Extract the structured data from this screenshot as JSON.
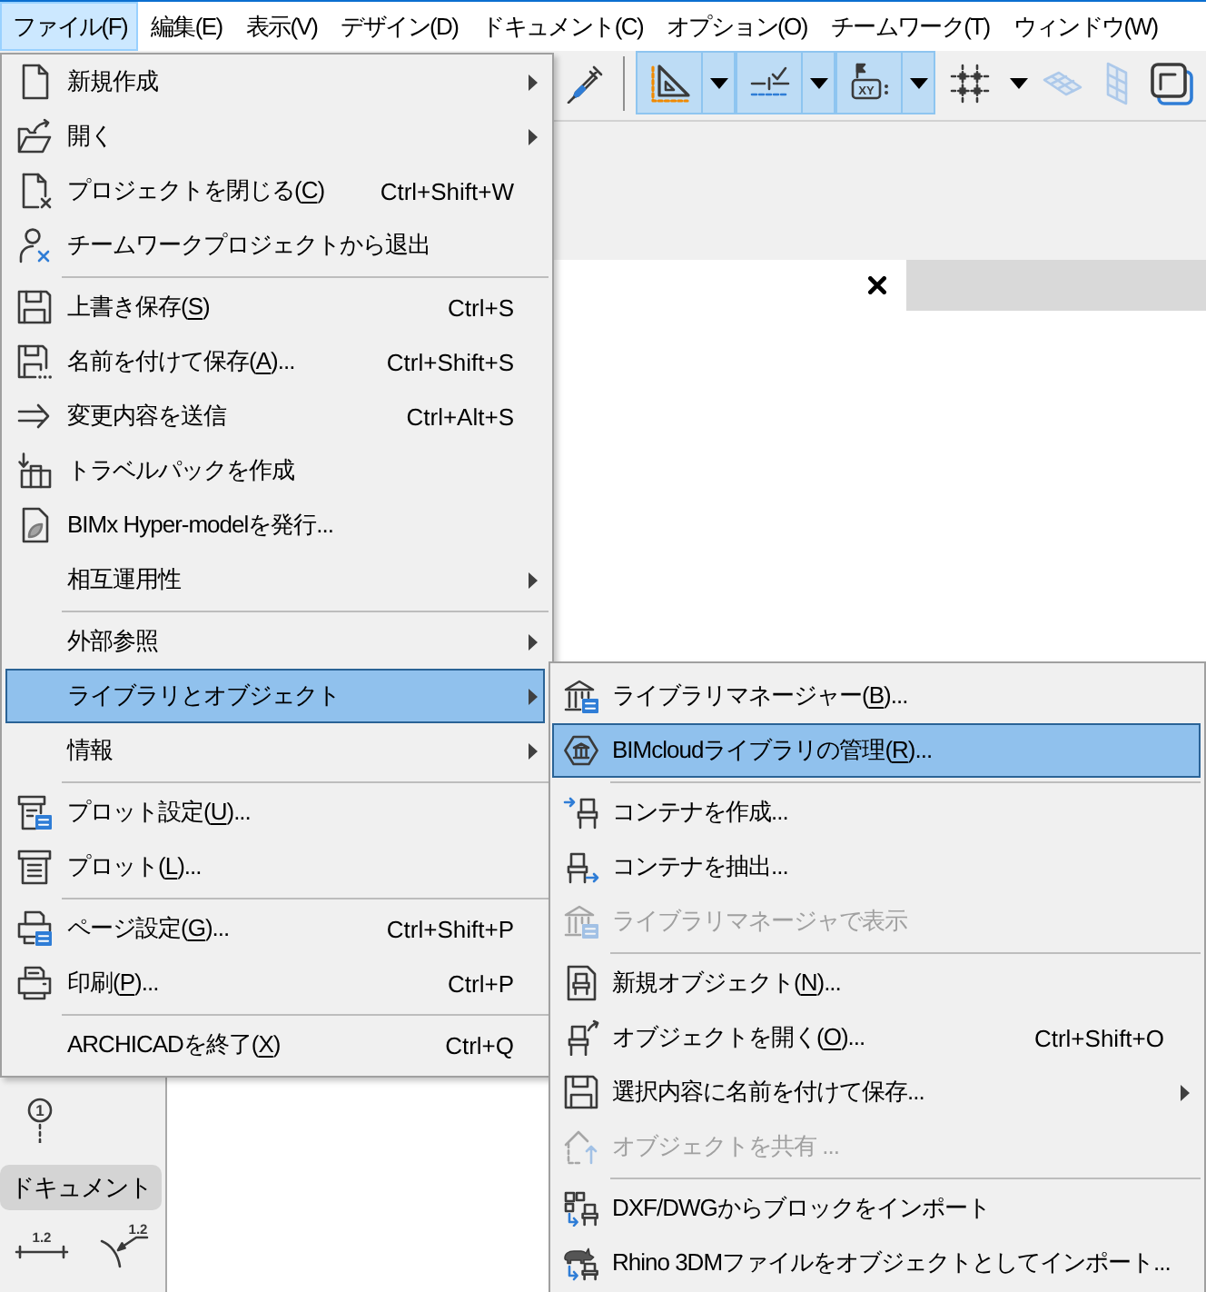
{
  "menu_bar": [
    {
      "label": "ファイル(F)",
      "selected": true
    },
    {
      "label": "編集(E)",
      "selected": false
    },
    {
      "label": "表示(V)",
      "selected": false
    },
    {
      "label": "デザイン(D)",
      "selected": false
    },
    {
      "label": "ドキュメント(C)",
      "selected": false
    },
    {
      "label": "オプション(O)",
      "selected": false
    },
    {
      "label": "チームワーク(T)",
      "selected": false
    },
    {
      "label": "ウィンドウ(W)",
      "selected": false
    }
  ],
  "toolbar": [
    {
      "kind": "button",
      "on": false,
      "disabled": false
    },
    {
      "kind": "separator"
    },
    {
      "kind": "split",
      "on": true
    },
    {
      "kind": "split",
      "on": true
    },
    {
      "kind": "split",
      "on": true,
      "caption": "XY"
    },
    {
      "kind": "split",
      "on": false
    },
    {
      "kind": "button",
      "on": false,
      "disabled": true
    },
    {
      "kind": "button",
      "on": false,
      "disabled": true
    },
    {
      "kind": "button",
      "on": false,
      "disabled": false
    }
  ],
  "view_tabs": [
    {
      "selected": true
    }
  ],
  "toolbox": {
    "tools": [
      {
        "kind": "marker",
        "caption": "1"
      }
    ],
    "section_title": "ドキュメント",
    "section_tools": [
      {
        "kind": "linear",
        "caption": "1.2"
      },
      {
        "kind": "radial",
        "caption": "1.2"
      }
    ]
  },
  "file_menu": {
    "groups": [
      [
        {
          "label": "新規作成",
          "submenu": true,
          "selected": false,
          "disabled": false
        },
        {
          "label": "開く",
          "submenu": true,
          "selected": false,
          "disabled": false
        },
        {
          "label": "プロジェクトを閉じる(C)",
          "mnemonic": true,
          "shortcut": "Ctrl+Shift+W",
          "submenu": false,
          "selected": false,
          "disabled": false
        },
        {
          "label": "チームワークプロジェクトから退出",
          "submenu": false,
          "selected": false,
          "disabled": false
        }
      ],
      [
        {
          "label": "上書き保存(S)",
          "mnemonic": true,
          "shortcut": "Ctrl+S",
          "submenu": false,
          "selected": false,
          "disabled": false
        },
        {
          "label": "名前を付けて保存(A)...",
          "mnemonic": true,
          "shortcut": "Ctrl+Shift+S",
          "submenu": false,
          "selected": false,
          "disabled": false
        },
        {
          "label": "変更内容を送信",
          "shortcut": "Ctrl+Alt+S",
          "submenu": false,
          "selected": false,
          "disabled": false
        },
        {
          "label": "トラベルパックを作成",
          "submenu": false,
          "selected": false,
          "disabled": false
        },
        {
          "label": "BIMx Hyper-modelを発行...",
          "submenu": false,
          "selected": false,
          "disabled": false
        },
        {
          "label": "相互運用性",
          "submenu": true,
          "selected": false,
          "disabled": false
        }
      ],
      [
        {
          "label": "外部参照",
          "submenu": true,
          "selected": false,
          "disabled": false
        },
        {
          "label": "ライブラリとオブジェクト",
          "submenu": true,
          "selected": true,
          "disabled": false
        },
        {
          "label": "情報",
          "submenu": true,
          "selected": false,
          "disabled": false
        }
      ],
      [
        {
          "label": "プロット設定(U)...",
          "mnemonic": true,
          "submenu": false,
          "selected": false,
          "disabled": false
        },
        {
          "label": "プロット(L)...",
          "mnemonic": true,
          "submenu": false,
          "selected": false,
          "disabled": false
        }
      ],
      [
        {
          "label": "ページ設定(G)...",
          "mnemonic": true,
          "shortcut": "Ctrl+Shift+P",
          "submenu": false,
          "selected": false,
          "disabled": false
        },
        {
          "label": "印刷(P)...",
          "mnemonic": true,
          "shortcut": "Ctrl+P",
          "submenu": false,
          "selected": false,
          "disabled": false
        }
      ],
      [
        {
          "label": "ARCHICADを終了(X)",
          "mnemonic": true,
          "shortcut": "Ctrl+Q",
          "submenu": false,
          "selected": false,
          "disabled": false
        }
      ]
    ]
  },
  "library_submenu": {
    "groups": [
      [
        {
          "label": "ライブラリマネージャー(B)...",
          "mnemonic": true,
          "submenu": false,
          "selected": false,
          "disabled": false
        },
        {
          "label": "BIMcloudライブラリの管理(R)...",
          "mnemonic": true,
          "submenu": false,
          "selected": true,
          "disabled": false
        }
      ],
      [
        {
          "label": "コンテナを作成...",
          "submenu": false,
          "selected": false,
          "disabled": false
        },
        {
          "label": "コンテナを抽出...",
          "submenu": false,
          "selected": false,
          "disabled": false
        },
        {
          "label": "ライブラリマネージャで表示",
          "submenu": false,
          "selected": false,
          "disabled": true
        }
      ],
      [
        {
          "label": "新規オブジェクト(N)...",
          "mnemonic": true,
          "submenu": false,
          "selected": false,
          "disabled": false
        },
        {
          "label": "オブジェクトを開く(O)...",
          "mnemonic": true,
          "shortcut": "Ctrl+Shift+O",
          "submenu": false,
          "selected": false,
          "disabled": false
        },
        {
          "label": "選択内容に名前を付けて保存...",
          "submenu": true,
          "selected": false,
          "disabled": false
        },
        {
          "label": "オブジェクトを共有 ...",
          "submenu": false,
          "selected": false,
          "disabled": true
        }
      ],
      [
        {
          "label": "DXF/DWGからブロックをインポート",
          "submenu": false,
          "selected": false,
          "disabled": false
        },
        {
          "label": "Rhino 3DMファイルをオブジェクトとしてインポート...",
          "submenu": false,
          "selected": false,
          "disabled": false
        }
      ]
    ]
  }
}
